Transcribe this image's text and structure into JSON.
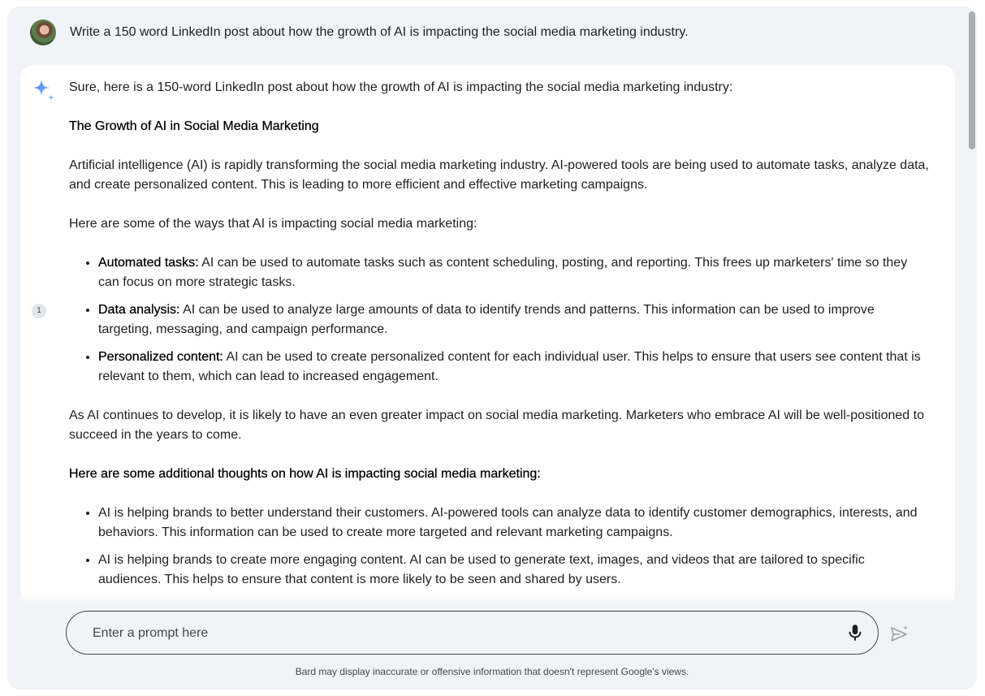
{
  "user_prompt": {
    "text": "Write a 150 word LinkedIn post about how the growth of AI is impacting the social media marketing industry."
  },
  "response": {
    "intro": "Sure, here is a 150-word LinkedIn post about how the growth of AI is impacting the social media marketing industry:",
    "title": "The Growth of AI in Social Media Marketing",
    "paragraph1": "Artificial intelligence (AI) is rapidly transforming the social media marketing industry. AI-powered tools are being used to automate tasks, analyze data, and create personalized content. This is leading to more efficient and effective marketing campaigns.",
    "paragraph2": "Here are some of the ways that AI is impacting social media marketing:",
    "list1": [
      {
        "label": "Automated tasks:",
        "text": " AI can be used to automate tasks such as content scheduling, posting, and reporting. This frees up marketers' time so they can focus on more strategic tasks."
      },
      {
        "label": "Data analysis:",
        "text": " AI can be used to analyze large amounts of data to identify trends and patterns. This information can be used to improve targeting, messaging, and campaign performance."
      },
      {
        "label": "Personalized content:",
        "text": " AI can be used to create personalized content for each individual user. This helps to ensure that users see content that is relevant to them, which can lead to increased engagement."
      }
    ],
    "paragraph3": "As AI continues to develop, it is likely to have an even greater impact on social media marketing. Marketers who embrace AI will be well-positioned to succeed in the years to come.",
    "heading2": "Here are some additional thoughts on how AI is impacting social media marketing:",
    "list2": [
      "AI is helping brands to better understand their customers. AI-powered tools can analyze data to identify customer demographics, interests, and behaviors. This information can be used to create more targeted and relevant marketing campaigns.",
      "AI is helping brands to create more engaging content. AI can be used to generate text, images, and videos that are tailored to specific audiences. This helps to ensure that content is more likely to be seen and shared by users."
    ],
    "citation_number": "1"
  },
  "input": {
    "placeholder": "Enter a prompt here",
    "value": ""
  },
  "icons": {
    "avatar": "user-avatar",
    "assistant": "sparkle-icon",
    "mic": "microphone-icon",
    "send": "send-icon"
  },
  "colors": {
    "frame_bg": "#f0f4f9",
    "sparkle": "#4285f4",
    "text": "#1f1f1f"
  },
  "disclaimer": "Bard may display inaccurate or offensive information that doesn't represent Google's views."
}
